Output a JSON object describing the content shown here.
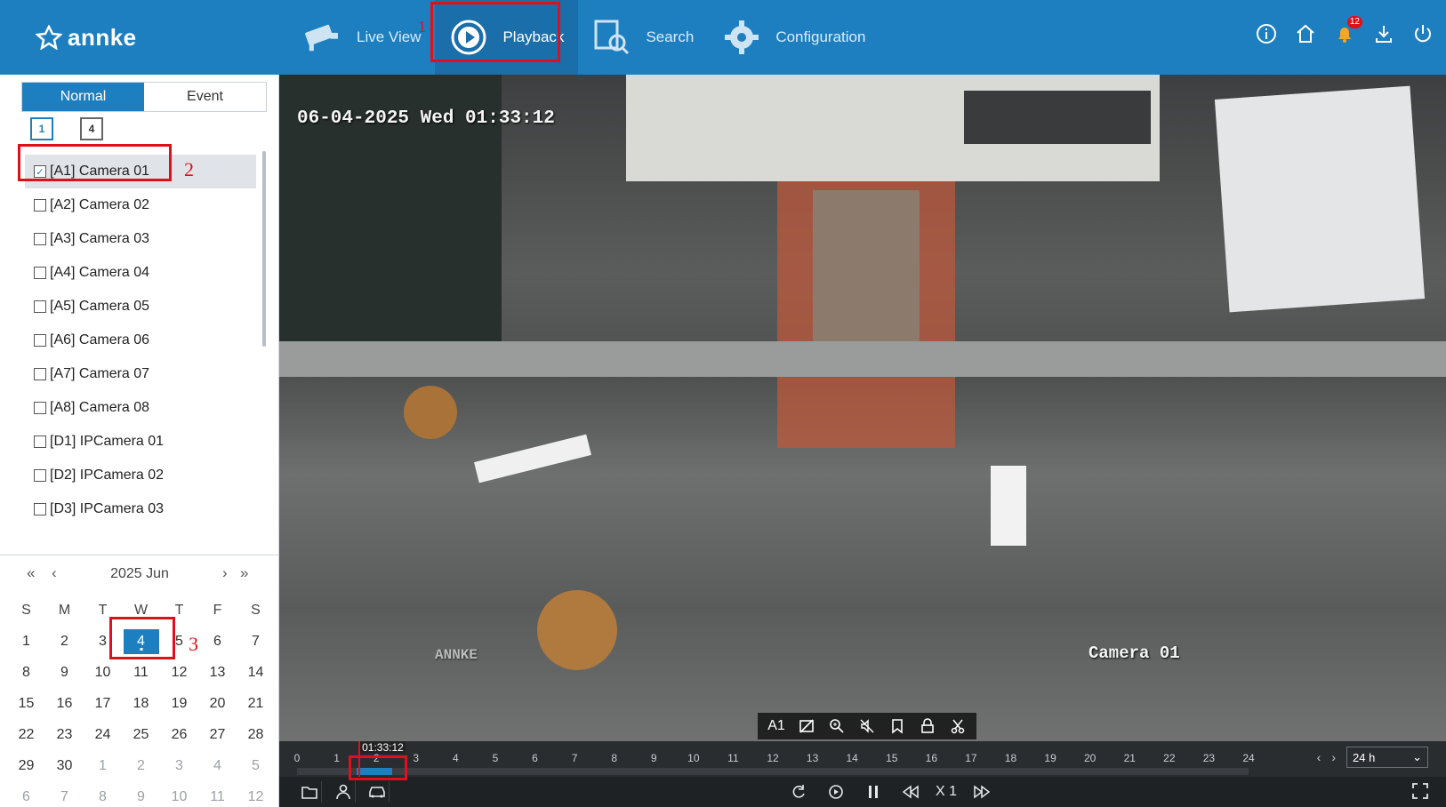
{
  "header": {
    "brand": "annke",
    "nav": [
      {
        "label": "Live View",
        "icon": "camera-icon"
      },
      {
        "label": "Playback",
        "icon": "play-circle-icon"
      },
      {
        "label": "Search",
        "icon": "search-document-icon"
      },
      {
        "label": "Configuration",
        "icon": "gear-icon"
      }
    ],
    "notification_count": "12",
    "right_icons": [
      "info-icon",
      "home-icon",
      "bell-icon",
      "download-icon",
      "power-icon"
    ]
  },
  "annotations": [
    "1",
    "2",
    "3"
  ],
  "sidebar": {
    "tabs": [
      {
        "label": "Normal"
      },
      {
        "label": "Event"
      }
    ],
    "split_buttons": [
      "1",
      "4"
    ],
    "cameras": [
      {
        "label": "[A1] Camera 01",
        "checked": true
      },
      {
        "label": "[A2] Camera 02",
        "checked": false
      },
      {
        "label": "[A3] Camera 03",
        "checked": false
      },
      {
        "label": "[A4] Camera 04",
        "checked": false
      },
      {
        "label": "[A5] Camera 05",
        "checked": false
      },
      {
        "label": "[A6] Camera 06",
        "checked": false
      },
      {
        "label": "[A7] Camera 07",
        "checked": false
      },
      {
        "label": "[A8] Camera 08",
        "checked": false
      },
      {
        "label": "[D1] IPCamera 01",
        "checked": false
      },
      {
        "label": "[D2] IPCamera 02",
        "checked": false
      },
      {
        "label": "[D3] IPCamera 03",
        "checked": false
      }
    ]
  },
  "calendar": {
    "title": "2025 Jun",
    "nav": {
      "first": "«",
      "prev": "‹",
      "next": "›",
      "last": "»"
    },
    "weekdays": [
      "S",
      "M",
      "T",
      "W",
      "T",
      "F",
      "S"
    ],
    "days": [
      [
        "1",
        "2",
        "3",
        "4",
        "5",
        "6",
        "7"
      ],
      [
        "8",
        "9",
        "10",
        "11",
        "12",
        "13",
        "14"
      ],
      [
        "15",
        "16",
        "17",
        "18",
        "19",
        "20",
        "21"
      ],
      [
        "22",
        "23",
        "24",
        "25",
        "26",
        "27",
        "28"
      ],
      [
        "29",
        "30",
        "1",
        "2",
        "3",
        "4",
        "5"
      ],
      [
        "6",
        "7",
        "8",
        "9",
        "10",
        "11",
        "12"
      ]
    ],
    "selected_day": "4"
  },
  "video": {
    "osd_timestamp": "06-04-2025 Wed 01:33:12",
    "osd_camera": "Camera 01",
    "osd_brand": "ANNKE",
    "toolbar": {
      "channel": "A1",
      "icons": [
        "no-image-icon",
        "zoom-in-icon",
        "mute-icon",
        "bookmark-icon",
        "lock-icon",
        "scissors-icon"
      ]
    }
  },
  "timeline": {
    "ticks": [
      "0",
      "1",
      "2",
      "3",
      "4",
      "5",
      "6",
      "7",
      "8",
      "9",
      "10",
      "11",
      "12",
      "13",
      "14",
      "15",
      "16",
      "17",
      "18",
      "19",
      "20",
      "21",
      "22",
      "23",
      "24"
    ],
    "cursor_time": "01:33:12",
    "cursor_hour": 1.55,
    "recording": [
      {
        "start_hour": 1.5,
        "end_hour": 2.4
      }
    ],
    "zoom_label": "24 h",
    "zoom_nav": {
      "prev": "‹",
      "next": "›"
    }
  },
  "controls": {
    "left_icons": [
      "folder-icon",
      "person-icon",
      "car-icon"
    ],
    "center_icons": [
      "reverse-icon",
      "slow-icon",
      "pause-icon",
      "rewind-icon",
      "fast-forward-icon"
    ],
    "speed": "X 1",
    "fullscreen_icon": "fullscreen-icon"
  },
  "colors": {
    "accent": "#1e7fc0",
    "highlight": "#e0101a",
    "header": "#1e7fc0"
  }
}
